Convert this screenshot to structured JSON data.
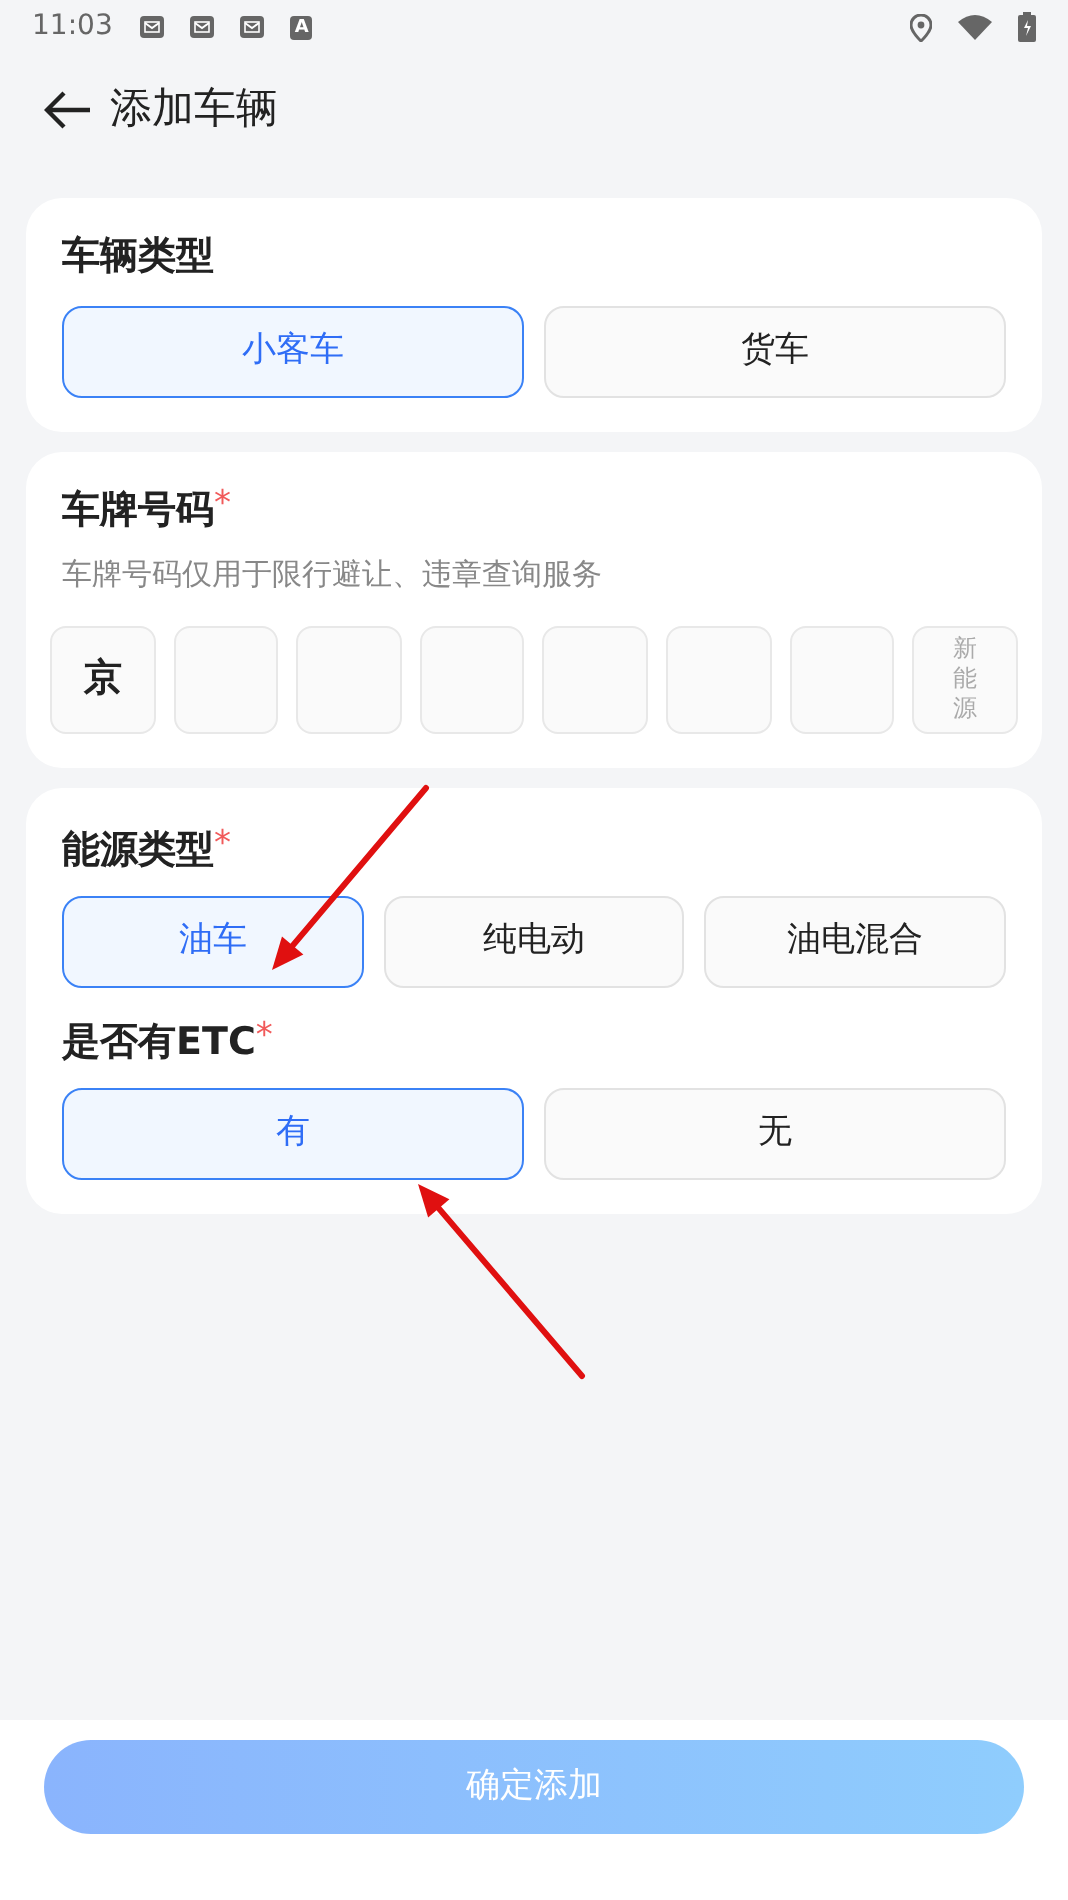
{
  "status_bar": {
    "time": "11:03",
    "notifications": [
      {
        "kind": "mail"
      },
      {
        "kind": "mail"
      },
      {
        "kind": "mail"
      },
      {
        "kind": "letter",
        "text": "A"
      }
    ]
  },
  "header": {
    "title": "添加车辆"
  },
  "vehicle_type": {
    "title": "车辆类型",
    "options": [
      {
        "label": "小客车",
        "selected": true
      },
      {
        "label": "货车",
        "selected": false
      }
    ]
  },
  "plate": {
    "title": "车牌号码",
    "required_mark": "*",
    "hint": "车牌号码仅用于限行避让、违章查询服务",
    "cells": [
      {
        "kind": "filled",
        "text": "京"
      },
      {
        "kind": "empty"
      },
      {
        "kind": "empty"
      },
      {
        "kind": "empty"
      },
      {
        "kind": "empty"
      },
      {
        "kind": "empty"
      },
      {
        "kind": "empty"
      },
      {
        "kind": "new_energy",
        "text": "新能源"
      }
    ]
  },
  "energy_type": {
    "title": "能源类型",
    "required_mark": "*",
    "options": [
      {
        "label": "油车",
        "selected": true
      },
      {
        "label": "纯电动",
        "selected": false
      },
      {
        "label": "油电混合",
        "selected": false
      }
    ]
  },
  "etc": {
    "title": "是否有ETC",
    "required_mark": "*",
    "options": [
      {
        "label": "有",
        "selected": true
      },
      {
        "label": "无",
        "selected": false
      }
    ]
  },
  "submit": {
    "label": "确定添加",
    "disabled": true
  },
  "annotations": [
    {
      "kind": "arrow"
    },
    {
      "kind": "arrow"
    }
  ]
}
